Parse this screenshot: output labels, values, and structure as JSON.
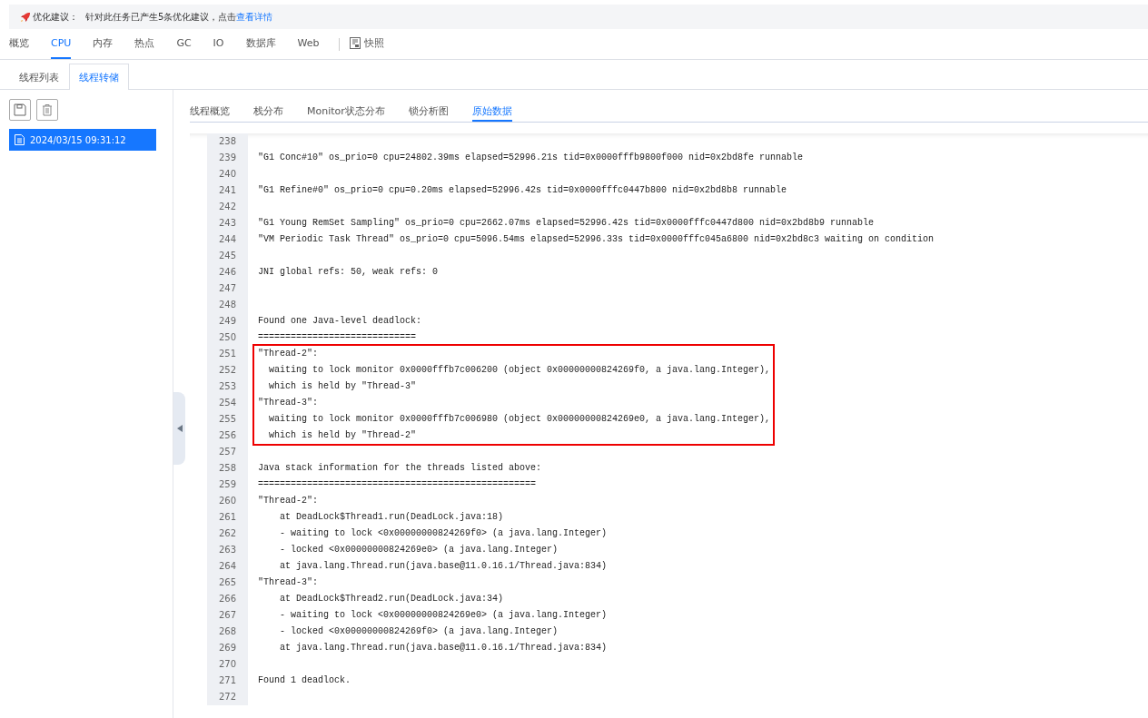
{
  "banner": {
    "title": "优化建议：",
    "message": "针对此任务已产生5条优化建议，点击",
    "link": "查看详情"
  },
  "main_tabs": [
    {
      "label": "概览",
      "selected": false
    },
    {
      "label": "CPU",
      "selected": true
    },
    {
      "label": "内存",
      "selected": false
    },
    {
      "label": "热点",
      "selected": false
    },
    {
      "label": "GC",
      "selected": false
    },
    {
      "label": "IO",
      "selected": false
    },
    {
      "label": "数据库",
      "selected": false
    },
    {
      "label": "Web",
      "selected": false
    }
  ],
  "snapshot_tab": {
    "label": "快照",
    "selected": false
  },
  "sub_tabs": [
    {
      "label": "线程列表",
      "selected": false
    },
    {
      "label": "线程转储",
      "selected": true
    }
  ],
  "dumps": [
    {
      "label": "2024/03/15 09:31:12",
      "selected": true
    }
  ],
  "view_tabs": [
    {
      "label": "线程概览",
      "selected": false
    },
    {
      "label": "栈分布",
      "selected": false
    },
    {
      "label": "Monitor状态分布",
      "selected": false
    },
    {
      "label": "锁分析图",
      "selected": false
    },
    {
      "label": "原始数据",
      "selected": true
    }
  ],
  "lines": [
    {
      "number": "238",
      "highlighted": false
    },
    {
      "number": "239",
      "text": "\"G1 Conc#10\" os_prio=0 cpu=24802.39ms elapsed=52996.21s tid=0x0000fffb9800f000 nid=0x2bd8fe runnable",
      "highlighted": false
    },
    {
      "number": "240",
      "highlighted": false
    },
    {
      "number": "241",
      "text": "\"G1 Refine#0\" os_prio=0 cpu=0.20ms elapsed=52996.42s tid=0x0000fffc0447b800 nid=0x2bd8b8 runnable",
      "highlighted": false
    },
    {
      "number": "242",
      "highlighted": false
    },
    {
      "number": "243",
      "text": "\"G1 Young RemSet Sampling\" os_prio=0 cpu=2662.07ms elapsed=52996.42s tid=0x0000fffc0447d800 nid=0x2bd8b9 runnable",
      "highlighted": false
    },
    {
      "number": "244",
      "text": "\"VM Periodic Task Thread\" os_prio=0 cpu=5096.54ms elapsed=52996.33s tid=0x0000fffc045a6800 nid=0x2bd8c3 waiting on condition",
      "highlighted": false
    },
    {
      "number": "245",
      "highlighted": false
    },
    {
      "number": "246",
      "text": "JNI global refs: 50, weak refs: 0",
      "highlighted": false
    },
    {
      "number": "247",
      "highlighted": false
    },
    {
      "number": "248",
      "highlighted": false
    },
    {
      "number": "249",
      "text": "Found one Java-level deadlock:",
      "highlighted": false
    },
    {
      "number": "250",
      "text": "=============================",
      "highlighted": false
    },
    {
      "number": "251",
      "text": "\"Thread-2\":",
      "highlighted": true
    },
    {
      "number": "252",
      "text": "  waiting to lock monitor 0x0000fffb7c006200 (object 0x00000000824269f0, a java.lang.Integer),",
      "highlighted": true
    },
    {
      "number": "253",
      "text": "  which is held by \"Thread-3\"",
      "highlighted": true
    },
    {
      "number": "254",
      "text": "\"Thread-3\":",
      "highlighted": true
    },
    {
      "number": "255",
      "text": "  waiting to lock monitor 0x0000fffb7c006980 (object 0x00000000824269e0, a java.lang.Integer),",
      "highlighted": true
    },
    {
      "number": "256",
      "text": "  which is held by \"Thread-2\"",
      "highlighted": true
    },
    {
      "number": "257",
      "highlighted": false
    },
    {
      "number": "258",
      "text": "Java stack information for the threads listed above:",
      "highlighted": false
    },
    {
      "number": "259",
      "text": "===================================================",
      "highlighted": false
    },
    {
      "number": "260",
      "text": "\"Thread-2\":",
      "highlighted": false
    },
    {
      "number": "261",
      "text": "    at DeadLock$Thread1.run(DeadLock.java:18)",
      "highlighted": false
    },
    {
      "number": "262",
      "text": "    - waiting to lock <0x00000000824269f0> (a java.lang.Integer)",
      "highlighted": false
    },
    {
      "number": "263",
      "text": "    - locked <0x00000000824269e0> (a java.lang.Integer)",
      "highlighted": false
    },
    {
      "number": "264",
      "text": "    at java.lang.Thread.run(java.base@11.0.16.1/Thread.java:834)",
      "highlighted": false
    },
    {
      "number": "265",
      "text": "\"Thread-3\":",
      "highlighted": false
    },
    {
      "number": "266",
      "text": "    at DeadLock$Thread2.run(DeadLock.java:34)",
      "highlighted": false
    },
    {
      "number": "267",
      "text": "    - waiting to lock <0x00000000824269e0> (a java.lang.Integer)",
      "highlighted": false
    },
    {
      "number": "268",
      "text": "    - locked <0x00000000824269f0> (a java.lang.Integer)",
      "highlighted": false
    },
    {
      "number": "269",
      "text": "    at java.lang.Thread.run(java.base@11.0.16.1/Thread.java:834)",
      "highlighted": false
    },
    {
      "number": "270",
      "highlighted": false
    },
    {
      "number": "271",
      "text": "Found 1 deadlock.",
      "highlighted": false
    },
    {
      "number": "272",
      "highlighted": false
    }
  ]
}
